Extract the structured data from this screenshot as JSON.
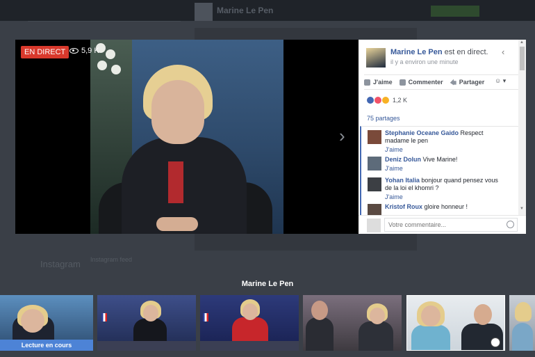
{
  "background": {
    "page_name": "Marine Le Pen",
    "instagram_label": "Instagram",
    "instagram_sub": "Instagram feed"
  },
  "video": {
    "live_label": "EN DIRECT",
    "viewers": "5,9 K",
    "icons": {
      "viewers": "eye-icon",
      "next": "chevron-right-icon"
    }
  },
  "panel": {
    "author": "Marine Le Pen",
    "status": " est en direct.",
    "time": "il y a environ une minute",
    "actions": {
      "like": "J'aime",
      "comment": "Commenter",
      "share": "Partager"
    },
    "reactions_count": "1,2 K",
    "shares": "75 partages",
    "comments": [
      {
        "author": "Stephanie Oceane Gaido",
        "text": " Respect madame le pen",
        "like": "J'aime"
      },
      {
        "author": "Deniz Dolun",
        "text": " Vive Marine!",
        "like": "J'aime"
      },
      {
        "author": "Yohan Italia",
        "text": " bonjour quand pensez vous de la loi el khomri ?",
        "like": "J'aime"
      },
      {
        "author": "Kristof Roux",
        "text": " gloire honneur !",
        "like": ""
      }
    ],
    "comment_placeholder": "Votre commentaire..."
  },
  "playlist": {
    "title": "Marine Le Pen",
    "now_playing": "Lecture en cours"
  },
  "colors": {
    "live_red": "#d9392c",
    "fb_blue": "#365899",
    "now_playing_blue": "#4d83d6"
  }
}
